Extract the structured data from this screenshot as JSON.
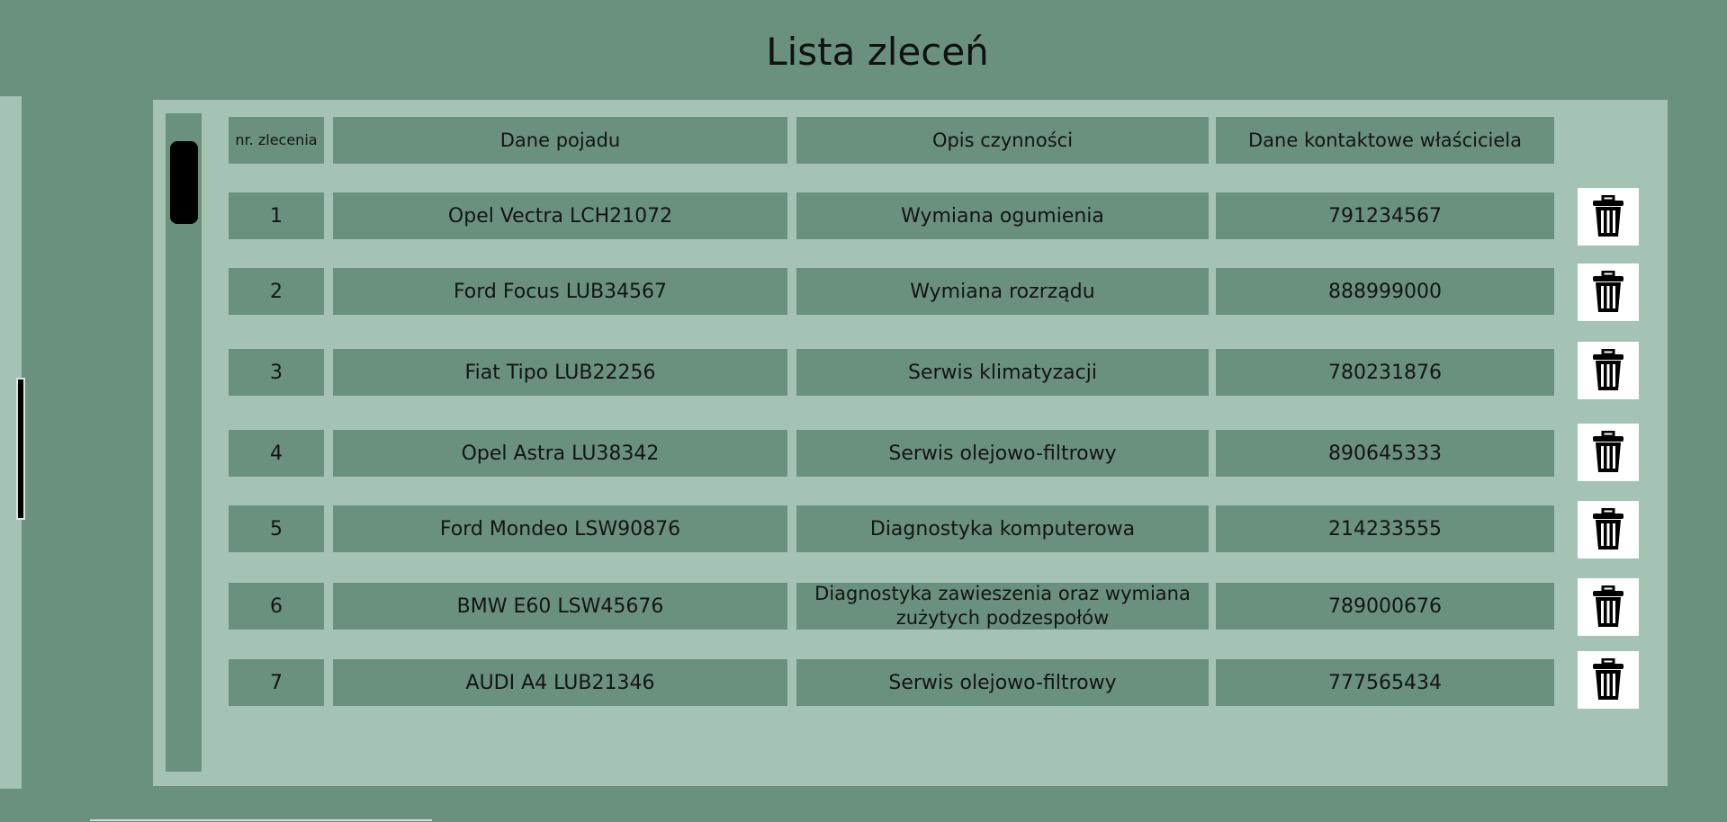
{
  "page": {
    "title": "Lista zleceń"
  },
  "table": {
    "headers": {
      "number": "nr. zlecenia",
      "vehicle": "Dane pojadu",
      "description": "Opis czynności",
      "contact": "Dane kontaktowe właściciela"
    },
    "rows": [
      {
        "number": "1",
        "vehicle": "Opel Vectra LCH21072",
        "description": "Wymiana ogumienia",
        "contact": "791234567"
      },
      {
        "number": "2",
        "vehicle": "Ford Focus LUB34567",
        "description": "Wymiana rozrządu",
        "contact": "888999000"
      },
      {
        "number": "3",
        "vehicle": "Fiat Tipo LUB22256",
        "description": "Serwis klimatyzacji",
        "contact": "780231876"
      },
      {
        "number": "4",
        "vehicle": "Opel Astra LU38342",
        "description": "Serwis olejowo-filtrowy",
        "contact": "890645333"
      },
      {
        "number": "5",
        "vehicle": "Ford Mondeo LSW90876",
        "description": "Diagnostyka komputerowa",
        "contact": "214233555"
      },
      {
        "number": "6",
        "vehicle": "BMW E60 LSW45676",
        "description": "Diagnostyka zawieszenia oraz wymiana zużytych podzespołów",
        "contact": "789000676"
      },
      {
        "number": "7",
        "vehicle": "AUDI A4 LUB21346",
        "description": "Serwis olejowo-filtrowy",
        "contact": "777565434"
      }
    ],
    "row_action_icon": "trash-icon"
  },
  "colors": {
    "background": "#6a917e",
    "panel": "#a4c3b4",
    "cell": "#6a917e",
    "scroll_thumb": "#000000",
    "delete_button": "#ffffff"
  }
}
